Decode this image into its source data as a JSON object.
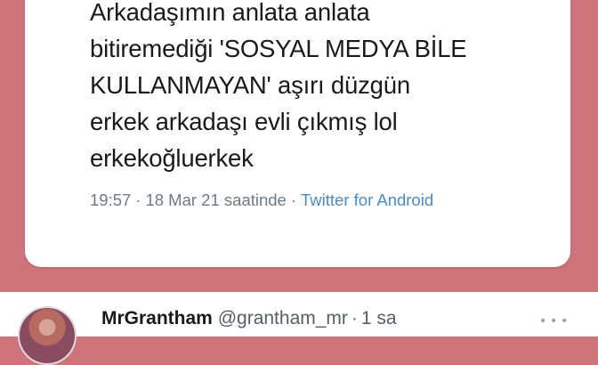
{
  "tweet": {
    "text_lines": [
      "Arkadaşımın anlata anlata",
      "bitiremediği 'SOSYAL MEDYA BİLE",
      "KULLANMAYAN' aşırı düzgün",
      "erkek arkadaşı evli çıkmış lol",
      "erkekoğluerkek"
    ],
    "time": "19:57",
    "date_text": "18 Mar 21 saatinde",
    "separator": "·",
    "source": "Twitter for Android"
  },
  "next_tweet": {
    "name": "MrGrantham",
    "handle": "@grantham_mr",
    "separator": "·",
    "age": "1 sa",
    "more_icon": "more-dots-icon"
  },
  "colors": {
    "background": "#cf737b",
    "link": "#4a8cc7",
    "meta": "#6e7b86"
  }
}
